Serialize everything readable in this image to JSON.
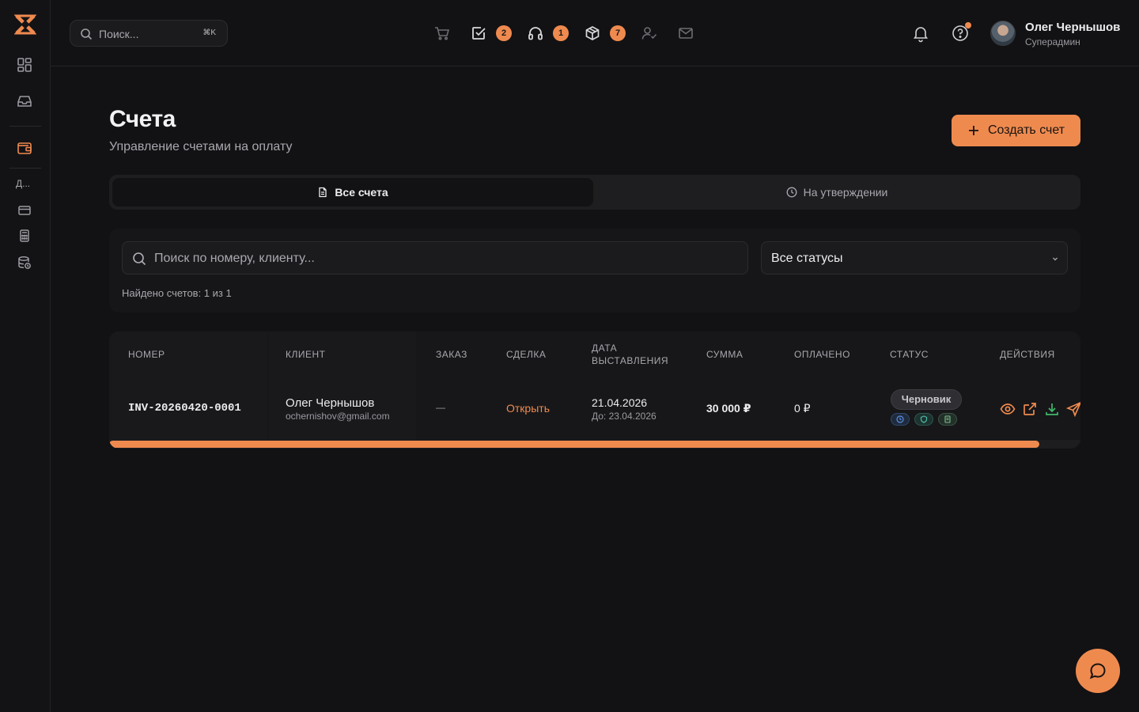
{
  "header": {
    "search_placeholder": "Поиск...",
    "search_shortcut": "⌘K",
    "badges": {
      "tasks": "2",
      "support": "1",
      "packages": "7"
    },
    "user": {
      "name": "Олег Чернышов",
      "role": "Суперадмин"
    }
  },
  "sidebar": {
    "truncated_label": "Д..."
  },
  "page": {
    "title": "Счета",
    "subtitle": "Управление счетами на оплату",
    "create_button": "Создать счет"
  },
  "tabs": [
    {
      "label": "Все счета",
      "active": true
    },
    {
      "label": "На утверждении",
      "active": false
    }
  ],
  "filters": {
    "search_placeholder": "Поиск по номеру, клиенту...",
    "status_select": "Все статусы",
    "found_text": "Найдено счетов: 1 из 1"
  },
  "table": {
    "columns": [
      "Номер",
      "Клиент",
      "Заказ",
      "Сделка",
      "Дата",
      "выставления",
      "Сумма",
      "Оплачено",
      "Статус",
      "Действия"
    ],
    "rows": [
      {
        "number": "INV-20260420-0001",
        "client_name": "Олег Чернышов",
        "client_email": "ochernishov@gmail.com",
        "order": "—",
        "deal": "Открыть",
        "issue_date": "21.04.2026",
        "due_date": "До: 23.04.2026",
        "amount": "30 000 ₽",
        "paid": "0 ₽",
        "status": "Черновик"
      }
    ]
  },
  "colors": {
    "accent": "#ef8a4f",
    "background": "#121214",
    "success": "#3fb96b"
  }
}
